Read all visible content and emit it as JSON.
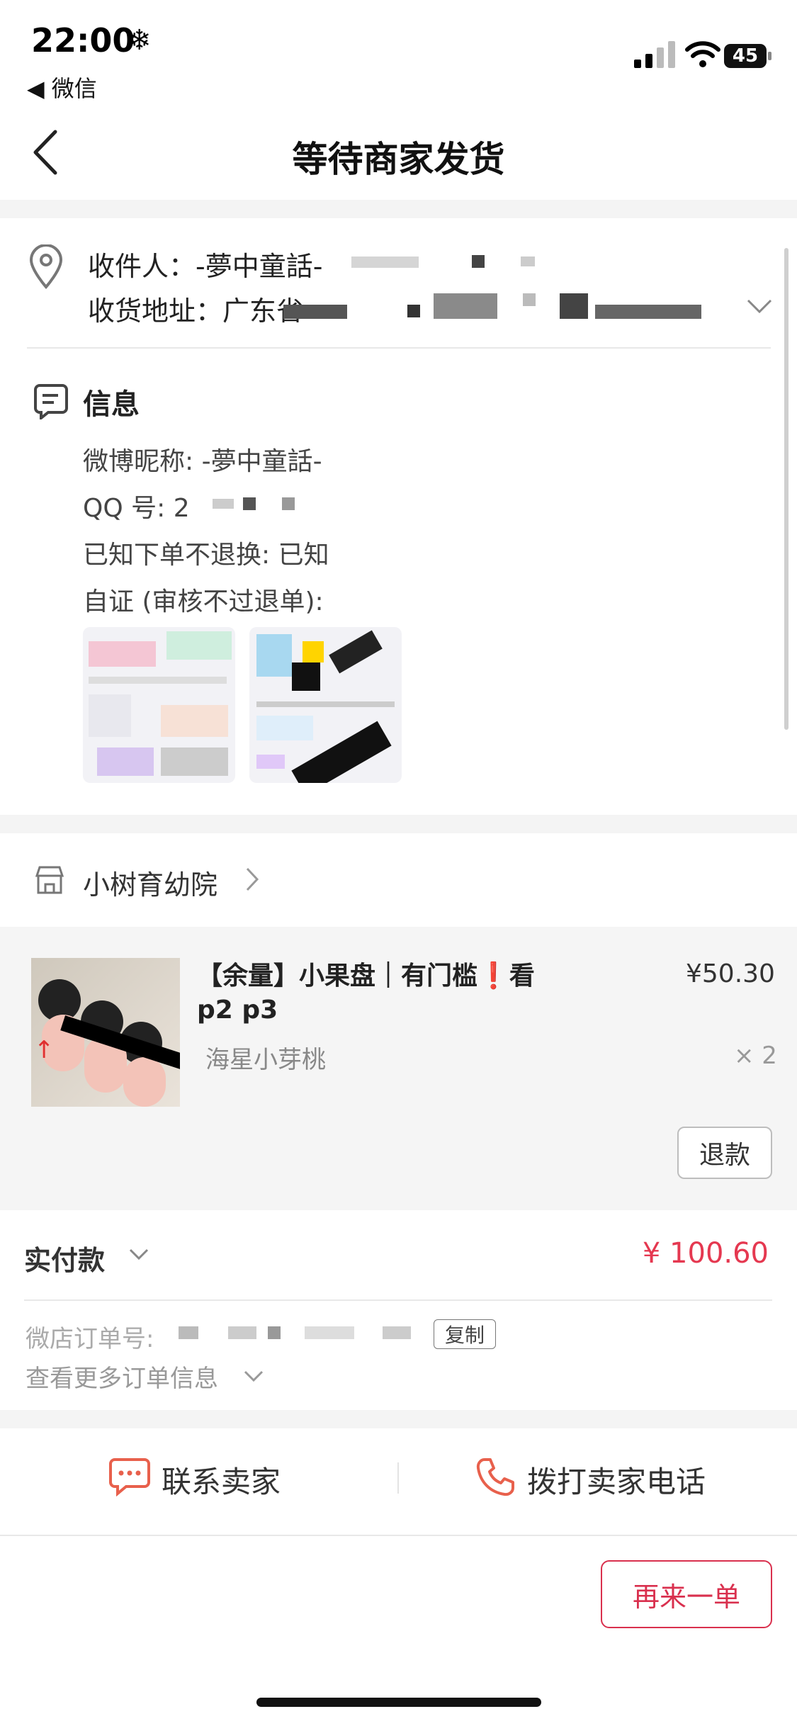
{
  "status_bar": {
    "time": "22:00",
    "weather_icon": "snowflake-icon",
    "back_app": "◀ 微信",
    "battery": "45"
  },
  "nav": {
    "title": "等待商家发货"
  },
  "address": {
    "recipient_label": "收件人：-夢中童話-",
    "address_label": "收货地址：广东省"
  },
  "info": {
    "title": "信息",
    "weibo": "微博昵称: -夢中童話-",
    "qq": "QQ 号: 2",
    "known": "已知下单不退换: 已知",
    "proof": "自证 (审核不过退单):"
  },
  "shop": {
    "name": "小树育幼院"
  },
  "product": {
    "title": "【余量】小果盘｜有门槛❗看 p2 p3",
    "price": "¥50.30",
    "sku": "海星小芽桃",
    "qty": "× 2",
    "refund_label": "退款"
  },
  "payment": {
    "paid_label": "实付款",
    "amount": "¥ 100.60",
    "order_no_label": "微店订单号:",
    "copy_label": "复制",
    "more_info_label": "查看更多订单信息"
  },
  "actions": {
    "contact_seller": "联系卖家",
    "call_seller": "拨打卖家电话",
    "reorder": "再来一单"
  },
  "colors": {
    "accent": "#e53850",
    "brand_red": "#d9304e",
    "icon_orange": "#e8604c"
  }
}
